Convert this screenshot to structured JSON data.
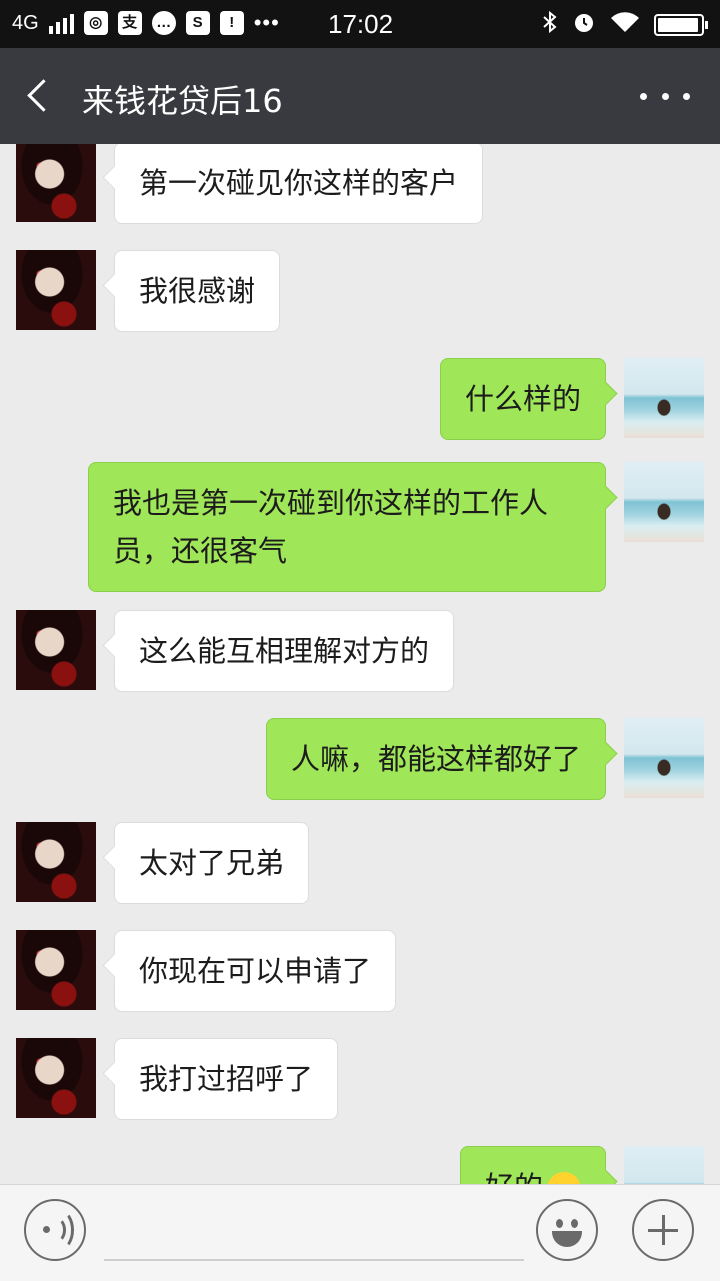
{
  "status_bar": {
    "network": "4G",
    "time": "17:02",
    "more": "•••",
    "icons": [
      "signal-icon",
      "wechat-icon",
      "alipay-icon",
      "chat-icon",
      "screenshot-icon",
      "data-warning-icon",
      "bluetooth-icon",
      "alarm-icon",
      "wifi-icon",
      "battery-icon"
    ],
    "signal_bars": 4,
    "battery_level": 0.95
  },
  "header": {
    "title": "来钱花贷后16",
    "back_icon": "back-arrow-icon",
    "more_icon": "more-dots-icon"
  },
  "messages": [
    {
      "side": "left",
      "text": "第一次碰见你这样的客户"
    },
    {
      "side": "left",
      "text": "我很感谢"
    },
    {
      "side": "right",
      "text": "什么样的"
    },
    {
      "side": "right",
      "text": "我也是第一次碰到你这样的工作人员，还很客气"
    },
    {
      "side": "left",
      "text": "这么能互相理解对方的"
    },
    {
      "side": "right",
      "text": "人嘛，都能这样都好了"
    },
    {
      "side": "left",
      "text": "太对了兄弟"
    },
    {
      "side": "left",
      "text": "你现在可以申请了"
    },
    {
      "side": "left",
      "text": "我打过招呼了"
    },
    {
      "side": "right",
      "text": "好的",
      "emoji": "smile-emoji-icon"
    }
  ],
  "input_bar": {
    "voice_icon": "voice-icon",
    "input_value": "",
    "emoji_icon": "emoji-icon",
    "plus_icon": "plus-icon"
  },
  "colors": {
    "status_bar_bg": "#121212",
    "title_bar_bg": "#393a3f",
    "chat_bg": "#ebebeb",
    "sent_bubble": "#9fe658",
    "received_bubble": "#ffffff"
  }
}
